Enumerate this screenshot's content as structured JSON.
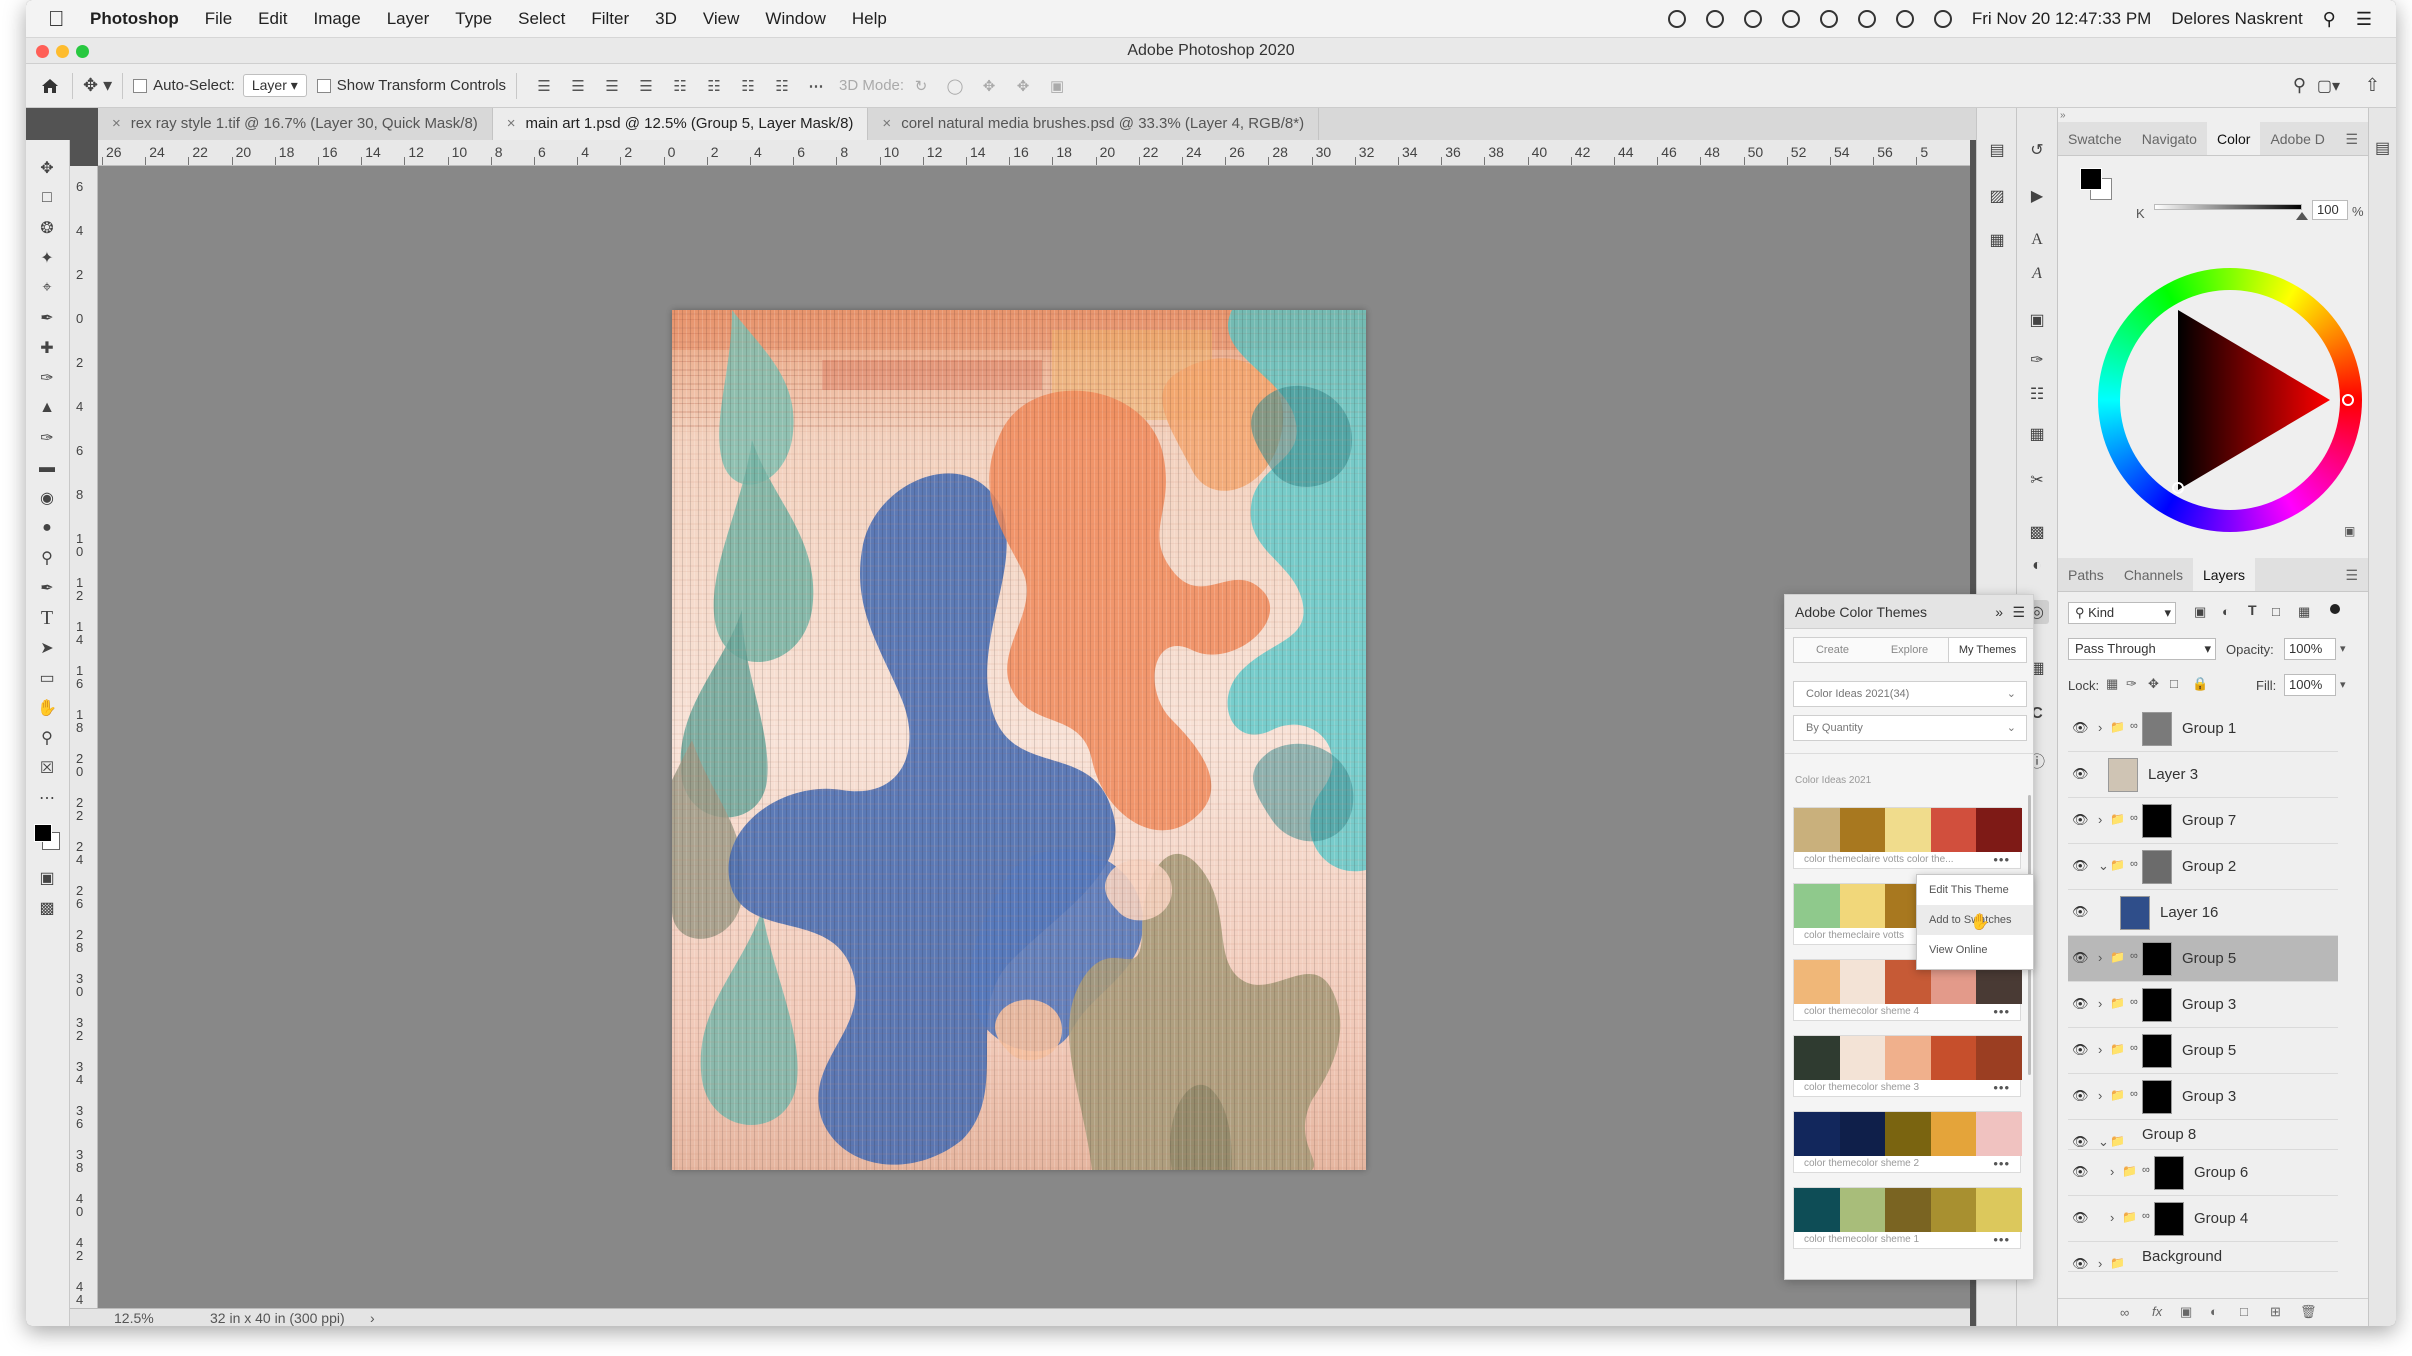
{
  "menubar": {
    "app_name": "Photoshop",
    "items": [
      "File",
      "Edit",
      "Image",
      "Layer",
      "Type",
      "Select",
      "Filter",
      "3D",
      "View",
      "Window",
      "Help"
    ],
    "clock": "Fri Nov 20  12:47:33 PM",
    "user": "Delores Naskrent"
  },
  "window": {
    "title": "Adobe Photoshop 2020"
  },
  "options_bar": {
    "auto_select_label": "Auto-Select:",
    "auto_select_value": "Layer",
    "show_transform_label": "Show Transform Controls",
    "mode_3d_label": "3D Mode:"
  },
  "doc_tabs": [
    {
      "label": "rex ray style 1.tif @ 16.7% (Layer 30, Quick Mask/8)",
      "active": false
    },
    {
      "label": "main art 1.psd @ 12.5% (Group 5, Layer Mask/8)",
      "active": true
    },
    {
      "label": "corel natural media brushes.psd @ 33.3% (Layer 4, RGB/8*)",
      "active": false
    }
  ],
  "ruler": {
    "h_ticks": [
      "26",
      "24",
      "22",
      "20",
      "18",
      "16",
      "14",
      "12",
      "10",
      "8",
      "6",
      "4",
      "2",
      "0",
      "2",
      "4",
      "6",
      "8",
      "10",
      "12",
      "14",
      "16",
      "18",
      "20",
      "22",
      "24",
      "26",
      "28",
      "30",
      "32",
      "34",
      "36",
      "38",
      "40",
      "42",
      "44",
      "46",
      "48",
      "50",
      "52",
      "54",
      "56",
      "5"
    ],
    "v_ticks": [
      "6",
      "4",
      "2",
      "0",
      "2",
      "4",
      "6",
      "8",
      "1\n0",
      "1\n2",
      "1\n4",
      "1\n6",
      "1\n8",
      "2\n0",
      "2\n2",
      "2\n4",
      "2\n6",
      "2\n8",
      "3\n0",
      "3\n2",
      "3\n4",
      "3\n6",
      "3\n8",
      "4\n0",
      "4\n2",
      "4\n4"
    ]
  },
  "status_bar": {
    "zoom": "12.5%",
    "doc_size": "32 in x 40 in (300 ppi)"
  },
  "color_panel": {
    "tabs": [
      "Swatche",
      "Navigato",
      "Color",
      "Adobe D"
    ],
    "active_tab": "Color",
    "k_label": "K",
    "k_value": "100",
    "k_unit": "%",
    "foreground": "#000000",
    "background": "#ffffff"
  },
  "layers_panel": {
    "tabs": [
      "Paths",
      "Channels",
      "Layers"
    ],
    "active_tab": "Layers",
    "filter_kind": "Kind",
    "blend_mode": "Pass Through",
    "opacity_label": "Opacity:",
    "opacity_value": "100%",
    "lock_label": "Lock:",
    "fill_label": "Fill:",
    "fill_value": "100%",
    "layers": [
      {
        "name": "Group 1",
        "type": "group",
        "thumb": "#7a7a7a",
        "selected": false,
        "indent": 0
      },
      {
        "name": "Layer 3",
        "type": "layer",
        "thumb": "#cfc4b4",
        "selected": false,
        "indent": 0
      },
      {
        "name": "Group 7",
        "type": "group",
        "thumb": "#000000",
        "selected": false,
        "indent": 0
      },
      {
        "name": "Group 2",
        "type": "group-open",
        "thumb": "#6b6b6b",
        "selected": false,
        "indent": 0
      },
      {
        "name": "Layer 16",
        "type": "layer",
        "thumb": "#2f4e8a",
        "selected": false,
        "indent": 1
      },
      {
        "name": "Group 5",
        "type": "group",
        "thumb": "#000000",
        "selected": true,
        "indent": 0
      },
      {
        "name": "Group 3",
        "type": "group",
        "thumb": "#000000",
        "selected": false,
        "indent": 0
      },
      {
        "name": "Group 5",
        "type": "group",
        "thumb": "#000000",
        "selected": false,
        "indent": 0
      },
      {
        "name": "Group 3",
        "type": "group",
        "thumb": "#000000",
        "selected": false,
        "indent": 0
      },
      {
        "name": "Group 8",
        "type": "group-open-nothumb",
        "thumb": "",
        "selected": false,
        "indent": 0
      },
      {
        "name": "Group 6",
        "type": "group",
        "thumb": "#000000",
        "selected": false,
        "indent": 1
      },
      {
        "name": "Group 4",
        "type": "group",
        "thumb": "#000000",
        "selected": false,
        "indent": 1
      },
      {
        "name": "Background",
        "type": "group-nothumb",
        "thumb": "",
        "selected": false,
        "indent": 0
      }
    ]
  },
  "color_themes": {
    "title": "Adobe Color Themes",
    "tabs": [
      "Create",
      "Explore",
      "My Themes"
    ],
    "active_tab": "My Themes",
    "library": "Color Ideas 2021(34)",
    "sort": "By Quantity",
    "section": "Color Ideas 2021",
    "themes": [
      {
        "name": "color themeclaire votts color the...",
        "colors": [
          "#c9b07c",
          "#a8781f",
          "#f0dc8c",
          "#d14f3d",
          "#7e1a16"
        ]
      },
      {
        "name": "color themeclaire votts",
        "colors": [
          "#8fc98c",
          "#f1d77a",
          "#a8781f",
          "#e2a06b",
          "#b05a34"
        ]
      },
      {
        "name": "color themecolor sheme 4",
        "colors": [
          "#f0b778",
          "#f3e3d6",
          "#c65a36",
          "#e39a8a",
          "#493a34"
        ]
      },
      {
        "name": "color themecolor sheme 3",
        "colors": [
          "#2f3b30",
          "#f3e3d6",
          "#f0b08c",
          "#c64f2c",
          "#9b3e22"
        ]
      },
      {
        "name": "color themecolor sheme 2",
        "colors": [
          "#12275c",
          "#0f1f4a",
          "#7a6410",
          "#e4a43a",
          "#f0c2c0"
        ]
      },
      {
        "name": "color themecolor sheme 1",
        "colors": [
          "#0e4d56",
          "#a8bd7a",
          "#7a6422",
          "#a89030",
          "#dcc85c"
        ]
      }
    ],
    "context_menu": [
      "Edit This Theme",
      "Add to Swatches",
      "View Online"
    ]
  }
}
